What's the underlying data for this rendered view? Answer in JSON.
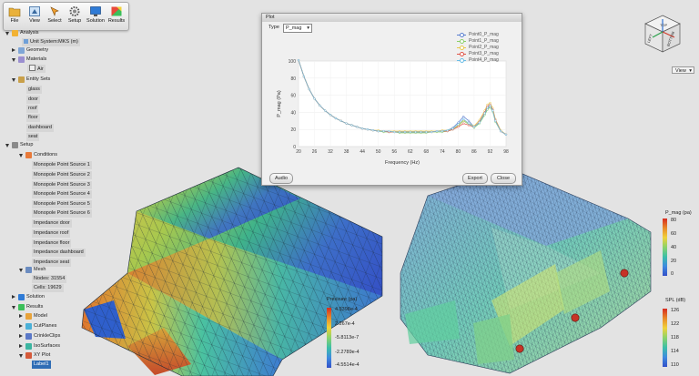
{
  "toolbar": {
    "items": [
      {
        "label": "File"
      },
      {
        "label": "View"
      },
      {
        "label": "Select"
      },
      {
        "label": "Setup"
      },
      {
        "label": "Solution"
      },
      {
        "label": "Results"
      }
    ]
  },
  "tree": {
    "analysis": "Analysis",
    "unit_system": "Unit System:MKS (m)",
    "geometry": "Geometry",
    "materials": "Materials",
    "air": "Air",
    "entity_sets": "Entity Sets",
    "entity_items": [
      "glass",
      "door",
      "roof",
      "floor",
      "dashboard",
      "seat"
    ],
    "setup": "Setup",
    "conditions": "Conditions",
    "condition_items": [
      "Monopole Point Source 1",
      "Monopole Point Source 2",
      "Monopole Point Source 3",
      "Monopole Point Source 4",
      "Monopole Point Source 5",
      "Monopole Point Source 6",
      "Impedance door",
      "Impedance roof",
      "Impedance floor",
      "Impedance dashboard",
      "Impedance seat"
    ],
    "mesh": "Mesh",
    "nodes": "Nodes: 31554",
    "cells": "Cells: 19629",
    "solution": "Solution",
    "results": "Results",
    "result_items": [
      "Model",
      "CutPlanes",
      "CrinkleClips",
      "IsoSurfaces",
      "XY Plot"
    ],
    "selected_item": "Label1"
  },
  "plot": {
    "title": "Plot",
    "type_label": "Type",
    "type_value": "P_mag",
    "audio_button": "Audio",
    "export_button": "Export",
    "close_button": "Close"
  },
  "chart_data": {
    "type": "line",
    "xlabel": "Frequency (Hz)",
    "ylabel": "P_mag (Pa)",
    "xlim": [
      20,
      98
    ],
    "ylim": [
      0,
      100
    ],
    "x_ticks": [
      20,
      26,
      32,
      38,
      44,
      50,
      56,
      62,
      68,
      74,
      80,
      86,
      92,
      98
    ],
    "y_ticks": [
      0,
      20,
      40,
      60,
      80,
      100
    ],
    "x": [
      20,
      22,
      24,
      26,
      28,
      30,
      32,
      34,
      36,
      38,
      40,
      42,
      44,
      46,
      48,
      50,
      52,
      54,
      56,
      58,
      60,
      62,
      64,
      66,
      68,
      70,
      72,
      74,
      76,
      78,
      80,
      82,
      84,
      86,
      88,
      90,
      91,
      92,
      93,
      94,
      96,
      98
    ],
    "series": [
      {
        "name": "Point0_P_mag",
        "color": "#5a7fd0",
        "values": [
          101,
          82,
          67,
          56,
          48,
          42,
          37,
          33,
          30,
          27,
          25,
          23,
          21,
          20,
          19,
          18,
          18,
          17,
          17,
          17,
          17,
          17,
          17,
          17,
          17,
          17,
          18,
          18,
          19,
          22,
          28,
          35,
          30,
          23,
          28,
          38,
          44,
          47,
          42,
          30,
          18,
          14
        ]
      },
      {
        "name": "Point1_P_mag",
        "color": "#8ccf6a",
        "values": [
          101,
          82,
          67,
          56,
          48,
          42,
          37,
          33,
          30,
          27,
          25,
          23,
          21,
          20,
          19,
          18,
          17,
          17,
          17,
          16,
          16,
          16,
          16,
          16,
          16,
          17,
          17,
          17,
          18,
          20,
          24,
          30,
          26,
          22,
          27,
          37,
          43,
          46,
          41,
          29,
          18,
          14
        ]
      },
      {
        "name": "Point2_P_mag",
        "color": "#e6c84a",
        "values": [
          101,
          82,
          67,
          56,
          48,
          42,
          37,
          33,
          30,
          27,
          25,
          23,
          21,
          20,
          19,
          19,
          18,
          18,
          18,
          18,
          18,
          18,
          18,
          18,
          18,
          18,
          18,
          19,
          19,
          21,
          25,
          31,
          27,
          24,
          31,
          42,
          49,
          51,
          45,
          32,
          19,
          14
        ]
      },
      {
        "name": "Point3_P_mag",
        "color": "#e0564a",
        "values": [
          101,
          82,
          67,
          56,
          48,
          42,
          37,
          33,
          30,
          27,
          25,
          23,
          21,
          20,
          19,
          18,
          18,
          17,
          17,
          17,
          17,
          17,
          17,
          17,
          17,
          17,
          18,
          18,
          18,
          20,
          23,
          27,
          25,
          23,
          29,
          40,
          47,
          49,
          43,
          31,
          18,
          14
        ]
      },
      {
        "name": "Point4_P_mag",
        "color": "#6bbde6",
        "values": [
          101,
          82,
          67,
          56,
          48,
          42,
          37,
          33,
          30,
          27,
          25,
          23,
          21,
          20,
          19,
          18,
          18,
          18,
          17,
          17,
          17,
          17,
          17,
          17,
          17,
          17,
          18,
          18,
          19,
          21,
          26,
          32,
          27,
          23,
          28,
          39,
          45,
          48,
          42,
          30,
          18,
          14
        ]
      }
    ]
  },
  "colorbar_pressure": {
    "title": "Pressure (pa)",
    "labels": [
      "4.5398e-4",
      "2.267e-4",
      "-5.8113e-7",
      "-2.2789e-4",
      "-4.5514e-4"
    ]
  },
  "colorbar_pmag": {
    "title": "P_mag (pa)",
    "labels": [
      "80",
      "60",
      "40",
      "20",
      "0"
    ]
  },
  "colorbar_spl": {
    "title": "SPL (dB)",
    "labels": [
      "126",
      "122",
      "118",
      "114",
      "110"
    ]
  },
  "view_dropdown": "View",
  "orientation_cube": {
    "top": "TOP",
    "left": "LEFT",
    "bottom": "BOTTOM"
  }
}
